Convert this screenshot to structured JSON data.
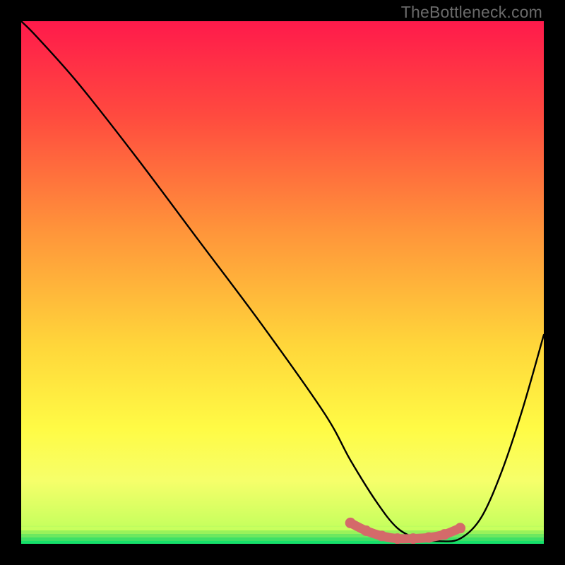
{
  "watermark": "TheBottleneck.com",
  "chart_data": {
    "type": "line",
    "title": "",
    "xlabel": "",
    "ylabel": "",
    "xlim": [
      0,
      100
    ],
    "ylim": [
      0,
      100
    ],
    "grid": false,
    "legend": false,
    "gradient_stops": [
      {
        "offset": 0.0,
        "color": "#ff1a4b"
      },
      {
        "offset": 0.18,
        "color": "#ff4a3f"
      },
      {
        "offset": 0.4,
        "color": "#ff943a"
      },
      {
        "offset": 0.62,
        "color": "#ffd63a"
      },
      {
        "offset": 0.78,
        "color": "#fffb45"
      },
      {
        "offset": 0.88,
        "color": "#f6ff6a"
      },
      {
        "offset": 0.965,
        "color": "#c8ff5e"
      },
      {
        "offset": 1.0,
        "color": "#16e06a"
      }
    ],
    "series": [
      {
        "name": "bottleneck-curve",
        "color": "#000000",
        "x": [
          0,
          3,
          11,
          22,
          34,
          46,
          58,
          63,
          68,
          72,
          76,
          80,
          84,
          88,
          92,
          96,
          100
        ],
        "y": [
          100,
          97,
          88,
          74,
          58,
          42,
          25,
          16,
          8,
          3,
          1,
          0.5,
          1,
          5,
          14,
          26,
          40
        ]
      }
    ],
    "marker_band": {
      "name": "sweet-spot",
      "color": "#d46a6a",
      "x": [
        63,
        66,
        69,
        72,
        75,
        78,
        81,
        84
      ],
      "y": [
        4,
        2.5,
        1.5,
        1,
        1,
        1.2,
        1.8,
        3
      ]
    }
  }
}
